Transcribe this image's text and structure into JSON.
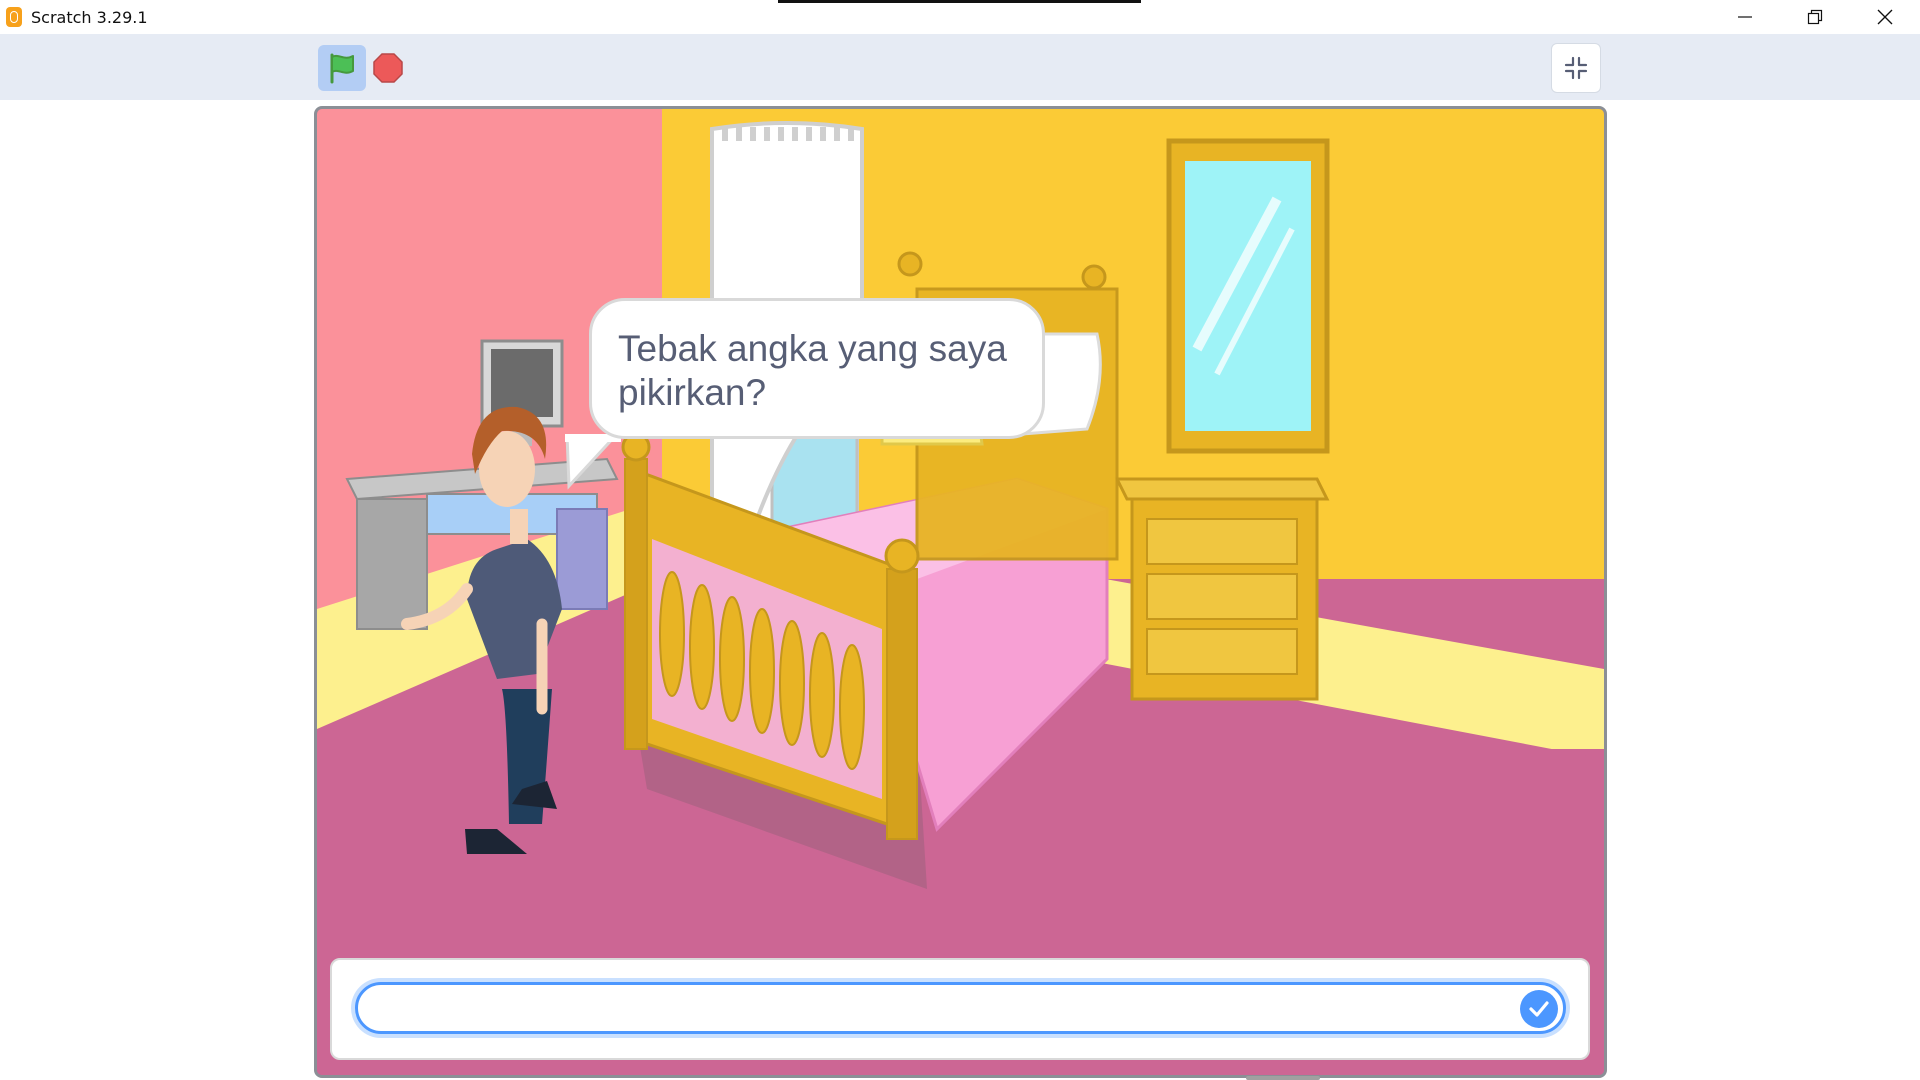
{
  "window": {
    "title": "Scratch 3.29.1",
    "controls": [
      "minimize",
      "restore",
      "close"
    ]
  },
  "toolbar": {
    "green_flag": "green-flag-icon",
    "stop": "stop-icon",
    "fullscreen_toggle": "shrink-screen-icon"
  },
  "stage": {
    "backdrop": "Bedroom",
    "sprite": "boy-character",
    "speech_bubble": "Tebak angka yang saya pikirkan?",
    "ask": {
      "input_value": "",
      "submit_icon": "check-icon"
    }
  },
  "colors": {
    "accent_blue": "#4c97ff",
    "flag_green": "#4cbf56",
    "stop_red": "#ec5959",
    "menubar": "#e6ebf4",
    "speech_text": "#575e75"
  }
}
